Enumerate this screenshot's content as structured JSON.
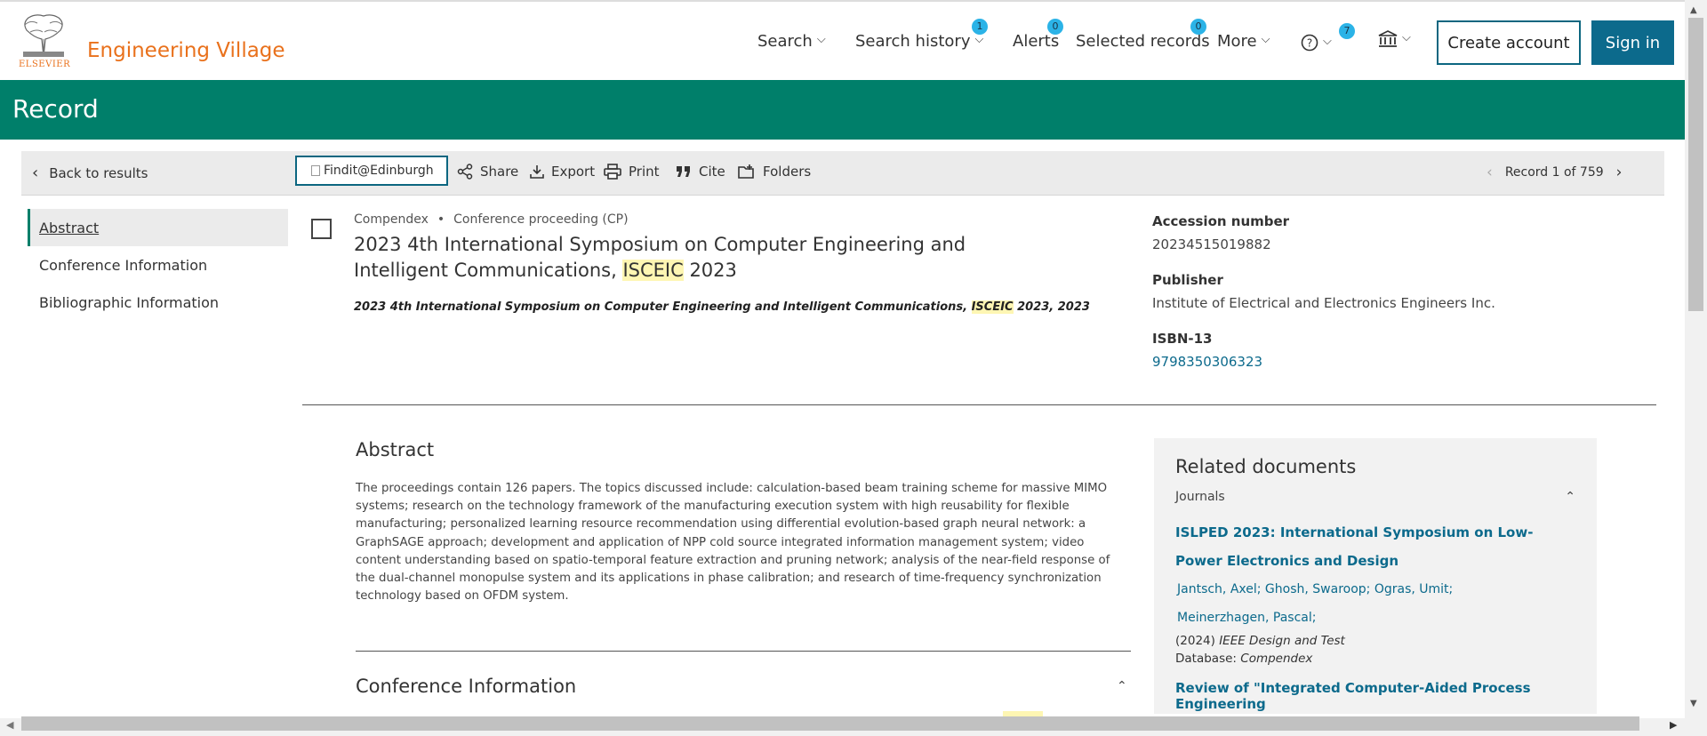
{
  "header": {
    "logo_text": "ELSEVIER",
    "brand": "Engineering Village",
    "nav": {
      "search": "Search",
      "search_history": "Search history",
      "search_history_badge": "1",
      "alerts": "Alerts",
      "alerts_badge": "0",
      "selected_records": "Selected records",
      "selected_records_badge": "0",
      "more": "More",
      "help_badge": "7"
    },
    "create_account": "Create account",
    "sign_in": "Sign in"
  },
  "band": {
    "title": "Record"
  },
  "toolbar": {
    "back": "Back to results",
    "findit": "Findit@Edinburgh",
    "share": "Share",
    "export": "Export",
    "print": "Print",
    "cite": "Cite",
    "folders": "Folders",
    "pager": "Record 1 of 759"
  },
  "left_nav": [
    "Abstract",
    "Conference Information",
    "Bibliographic Information"
  ],
  "record": {
    "database": "Compendex",
    "doc_type": "Conference proceeding (CP)",
    "title_pre": "2023 4th International Symposium on Computer Engineering and Intelligent Communications, ",
    "title_hl": "ISCEIC",
    "title_post": " 2023",
    "sub_pre": "2023 4th International Symposium on Computer Engineering and Intelligent Communications, ",
    "sub_hl": "ISCEIC",
    "sub_post": " 2023, 2023"
  },
  "side_info": {
    "accession_label": "Accession number",
    "accession_value": "20234515019882",
    "publisher_label": "Publisher",
    "publisher_value": "Institute of Electrical and Electronics Engineers Inc.",
    "isbn_label": "ISBN-13",
    "isbn_value": "9798350306323"
  },
  "abstract": {
    "heading": "Abstract",
    "text": "The proceedings contain 126 papers. The topics discussed include: calculation-based beam training scheme for massive MIMO systems; research on the technology framework of the manufacturing execution system with high reusability for flexible manufacturing; personalized learning resource recommendation using differential evolution-based graph neural network: a GraphSAGE approach; development and application of NPP cold source integrated information management system; video content understanding based on spatio-temporal feature extraction and pruning network; analysis of the near-field response of the dual-channel monopulse system and its applications in phase calibration; and research of time-frequency synchronization technology based on OFDM system."
  },
  "conference": {
    "heading": "Conference Information"
  },
  "related": {
    "heading": "Related documents",
    "section": "Journals",
    "doc1_title": "ISLPED 2023: International Symposium on Low-Power Electronics and Design",
    "doc1_authors_1": "Jantsch, Axel; Ghosh, Swaroop; Ogras, Umit;",
    "doc1_authors_2": "Meinerzhagen, Pascal;",
    "doc1_year": "(2024) ",
    "doc1_journal": "IEEE Design and Test",
    "doc1_db_label": "Database: ",
    "doc1_db": "Compendex",
    "doc2_title": "Review of \"Integrated Computer-Aided Process Engineering"
  }
}
